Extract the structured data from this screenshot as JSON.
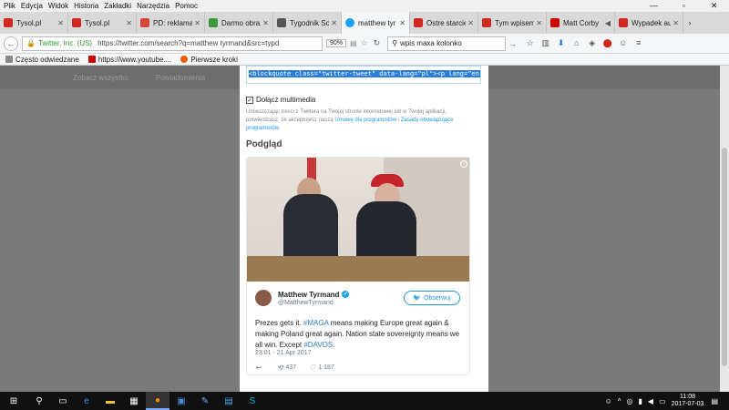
{
  "menubar": {
    "items": [
      "Plik",
      "Edycja",
      "Widok",
      "Historia",
      "Zakładki",
      "Narzędzia",
      "Pomoc"
    ]
  },
  "tabs": [
    {
      "title": "Tysol.pl",
      "color": "#d0281e",
      "active": false
    },
    {
      "title": "Tysol.pl",
      "color": "#d0281e",
      "active": false
    },
    {
      "title": "PD: reklama w ar",
      "color": "#d44638",
      "active": false
    },
    {
      "title": "Darmo obraz: Ka",
      "color": "#3c9a3c",
      "active": false
    },
    {
      "title": "Tygodnik Solidar",
      "color": "#555555",
      "active": false
    },
    {
      "title": "matthew tyr",
      "color": "#1da1f2",
      "active": true
    },
    {
      "title": "Ostre starcie poli",
      "color": "#d0281e",
      "active": false
    },
    {
      "title": "Tym wpisem Ma",
      "color": "#d0281e",
      "active": false
    },
    {
      "title": "Matt Corby",
      "color": "#cc0000",
      "active": false
    },
    {
      "title": "Wypadek autoka",
      "color": "#d0281e",
      "active": false
    }
  ],
  "navbar": {
    "site_label": "Twitter, Inc. (US)",
    "url": "https://twitter.com/search?q=matthew tyrmand&src=typd",
    "zoom": "90%",
    "search_value": "wpis maxa kolonko"
  },
  "bookmarks": [
    "Często odwiedzane",
    "https://www.youtube....",
    "Pierwsze kroki"
  ],
  "background": {
    "items": [
      "Zobacz wszystko",
      "Powiadomienia"
    ]
  },
  "modal": {
    "embed_code": "<blockquote class=\"twitter-tweet\" data-lang=\"pl\"><p lang=\"en\" dir=\"ltr\">P",
    "include_media_label": "Dołącz multimedia",
    "terms_prefix": "Umieszczając treści z Twittera na Twojej stronie internetowej lub w Twojej aplikacji, potwierdzasz, że akceptujesz naszą ",
    "terms_link1": "Umowę dla programistów",
    "terms_mid": " i ",
    "terms_link2": "Zasady obowiązujące programistów",
    "terms_suffix": ".",
    "preview_heading": "Podgląd"
  },
  "tweet": {
    "author_name": "Matthew Tyrmand",
    "author_handle": "@MatthewTyrmand",
    "follow_label": "Obserwuj",
    "text_1": "Prezes gets it. ",
    "tag_1": "#MAGA",
    "text_2": " means making Europe great again & making Poland great again. Nation state sovereignty means we all win. Except ",
    "tag_2": "#DAVOS",
    "text_3": ".",
    "timestamp": "23:01 - 21 Apr 2017",
    "retweets": "437",
    "likes": "1 187"
  },
  "taskbar": {
    "time": "11:08",
    "date": "2017-07-03"
  },
  "colors": {
    "twitter_blue": "#1da1f2",
    "link_blue": "#2b7bb9"
  }
}
